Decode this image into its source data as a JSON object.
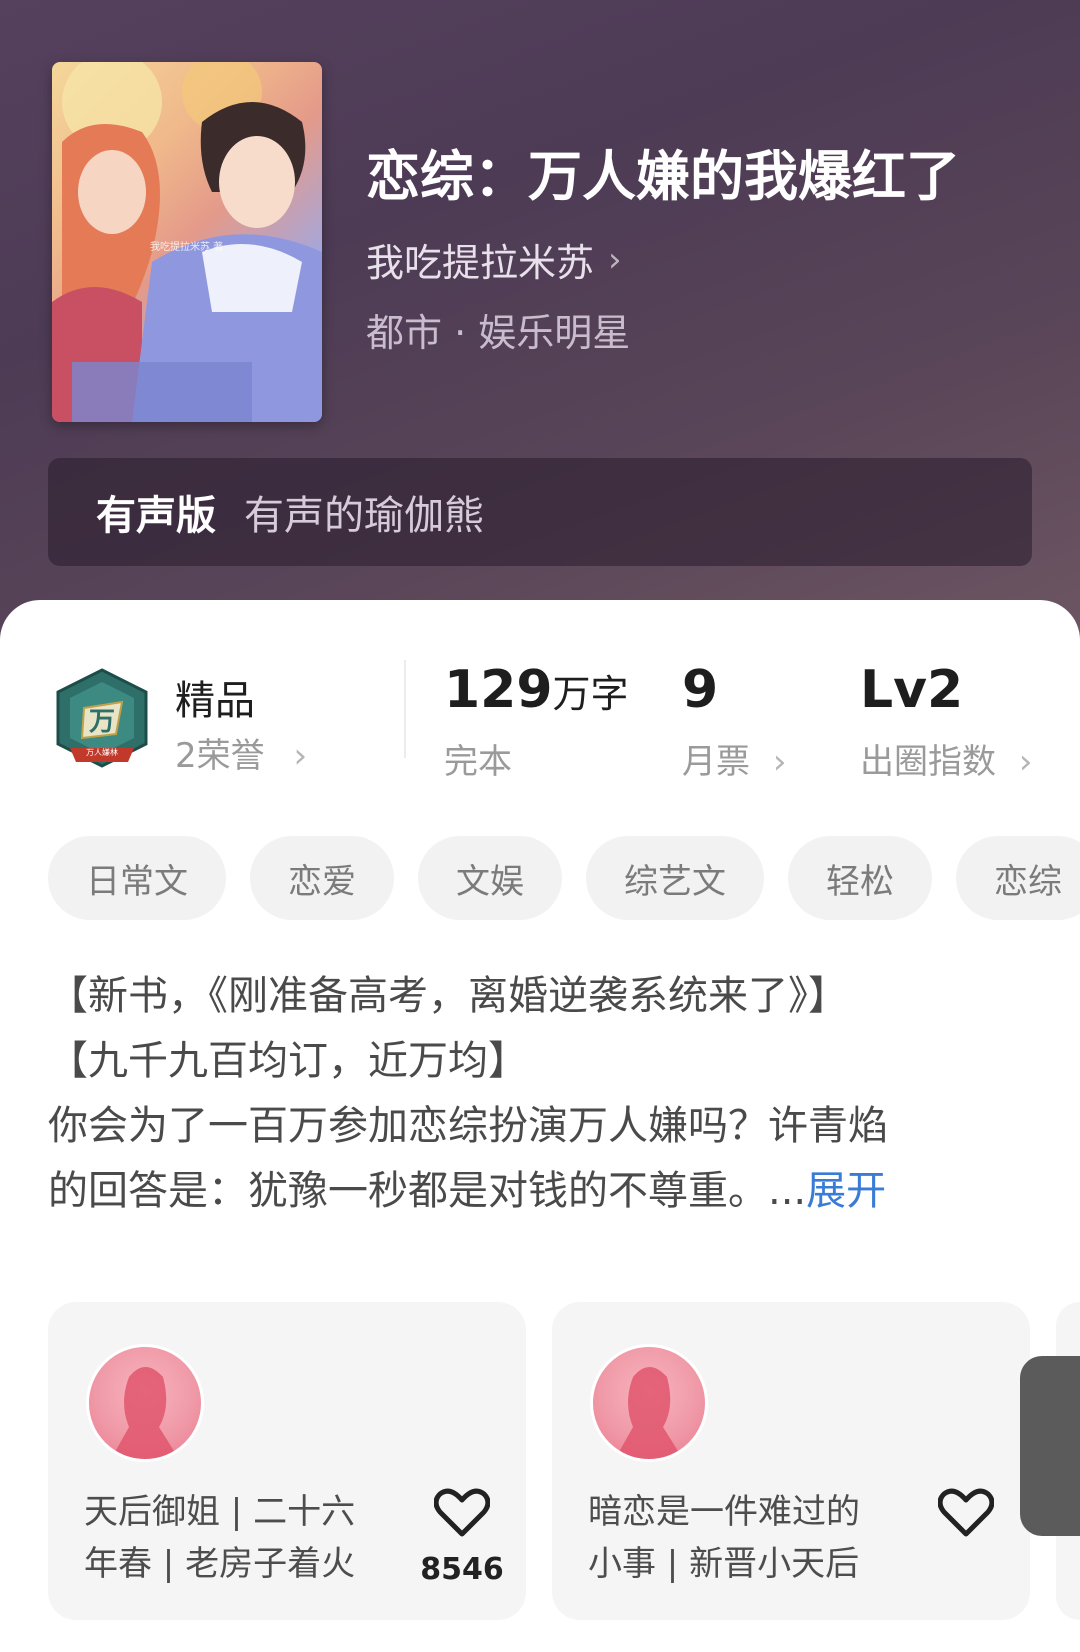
{
  "book": {
    "title": "恋综：万人嫌的我爆红了",
    "author": "我吃提拉米苏",
    "genre": "都市 · 娱乐明星"
  },
  "audio": {
    "label": "有声版",
    "name": "有声的瑜伽熊"
  },
  "stats": {
    "premium": "精品",
    "honor": "2荣誉",
    "word_count_num": "129",
    "word_count_unit": "万字",
    "status": "完本",
    "monthly_votes": "9",
    "monthly_votes_label": "月票",
    "level": "Lv2",
    "level_label": "出圈指数"
  },
  "badge_text": "万人嫌林",
  "cover_text": "我吃提拉米苏 著",
  "tags": [
    "日常文",
    "恋爱",
    "文娱",
    "综艺文",
    "轻松",
    "恋综"
  ],
  "description": {
    "line1": "【新书，《刚准备高考，离婚逆袭系统来了》】",
    "line2": "【九千九百均订，近万均】",
    "line3": "你会为了一百万参加恋综扮演万人嫌吗？许青焰",
    "line4": "的回答是：犹豫一秒都是对钱的不尊重。...",
    "expand": "展开"
  },
  "cards": [
    {
      "line1": "天后御姐 | 二十六",
      "line2": "年春 | 老房子着火",
      "likes": "8546"
    },
    {
      "line1": "暗恋是一件难过的",
      "line2": "小事 | 新晋小天后",
      "likes": ""
    }
  ],
  "colors": {
    "hero_bg": "#55405d",
    "accent_link": "#3a7bd5",
    "tag_bg": "#f2f2f2"
  }
}
